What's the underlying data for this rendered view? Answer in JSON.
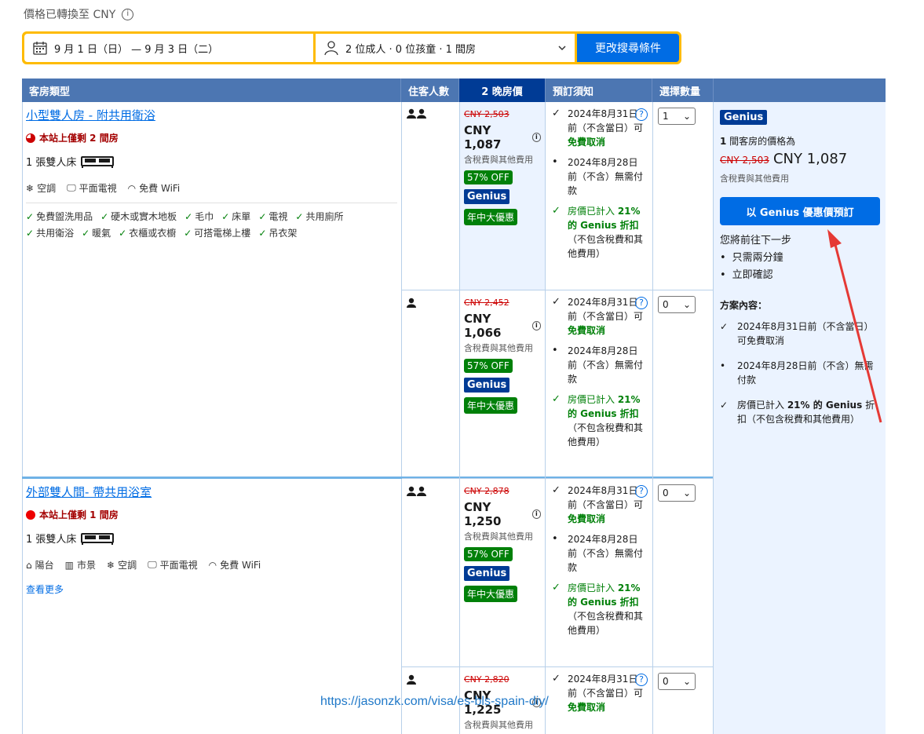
{
  "price_note": "價格已轉換至 CNY",
  "search": {
    "dates": "9 月 1 日（日） — 9 月 3 日（二）",
    "guests": "2 位成人 · 0 位孩童 · 1 間房",
    "button": "更改搜尋條件"
  },
  "headers": {
    "room_type": "客房類型",
    "guests": "住客人數",
    "price": "2 晚房價",
    "policy": "預訂須知",
    "qty": "選擇數量"
  },
  "rooms": [
    {
      "title": "小型雙人房 - 附共用衛浴",
      "scarcity": "本站上僅剩 2 間房",
      "bed": "1 張雙人床",
      "facilities": [
        "空調",
        "平面電視",
        "免費 WiFi"
      ],
      "amenities": [
        "免費盥洗用品",
        "硬木或實木地板",
        "毛巾",
        "床單",
        "電視",
        "共用廁所",
        "共用衛浴",
        "暖氣",
        "衣櫃或衣櫥",
        "可搭電梯上樓",
        "吊衣架"
      ]
    },
    {
      "title": "外部雙人間- 帶共用浴室",
      "scarcity": "本站上僅剩 1 間房",
      "bed": "1 張雙人床",
      "facilities": [
        "陽台",
        "市景",
        "空調",
        "平面電視",
        "免費 WiFi"
      ],
      "more": "查看更多"
    }
  ],
  "options": [
    {
      "old": "CNY 2,503",
      "cur": "CNY 1,087",
      "qty": "1"
    },
    {
      "old": "CNY 2,452",
      "cur": "CNY 1,066",
      "qty": "0"
    },
    {
      "old": "CNY 2,878",
      "cur": "CNY 1,250",
      "qty": "0"
    },
    {
      "old": "CNY 2,820",
      "cur": "CNY 1,225",
      "qty": "0"
    }
  ],
  "common": {
    "tax": "含稅費與其他費用",
    "off": "57% OFF",
    "genius": "Genius",
    "midyear": "年中大優惠",
    "pol1": "2024年8月31日前（不含當日）可",
    "pol1_b": "免費取消",
    "pol2": "2024年8月28日前（不含）無需付款",
    "pol3a": "房價已計入 ",
    "pol3b": "21%",
    "pol3c": "的 Genius 折扣",
    "pol3d": "（不包含稅費和其他費用）"
  },
  "book": {
    "genius": "Genius",
    "room_count": "1",
    "room_text": " 間客房的價格為",
    "old": "CNY 2,503",
    "new": "CNY 1,087",
    "tax": "含稅費與其他費用",
    "button": "以 Genius 優惠價預訂",
    "next": "您將前往下一步",
    "steps": [
      "只需兩分鐘",
      "立即確認"
    ],
    "plan_title": "方案內容：",
    "plan1": "2024年8月31日前（不含當日）可免費取消",
    "plan2": "2024年8月28日前（不含）無需付款",
    "plan3a": "房價已計入 ",
    "plan3b": "21% 的 Genius",
    "plan3c": " 折扣（不包含稅費和其他費用）"
  },
  "watermark": "https://jasonzk.com/visa/es-bls-spain-diy/",
  "colors": {
    "brand_blue": "#006ce4",
    "header_blue": "#4c76b2",
    "dark_blue": "#003b95",
    "yellow": "#febb02",
    "green": "#008009",
    "red": "#cc0000"
  }
}
